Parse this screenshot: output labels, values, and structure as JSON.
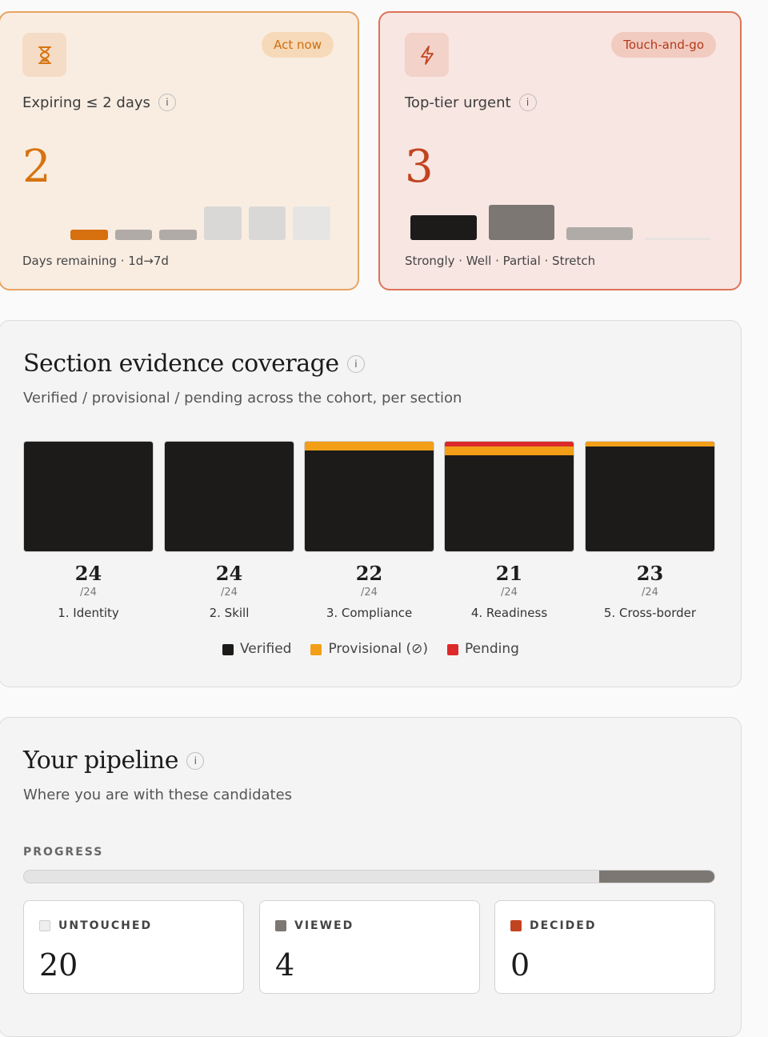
{
  "expiring_card": {
    "icon": "hourglass-icon",
    "badge": "Act now",
    "title": "Expiring ≤ 2 days",
    "value": "2",
    "footer": "Days remaining · 1d→7d",
    "accent": "#d77310",
    "bars": [
      {
        "level": 0.25,
        "color": "#d6700f"
      },
      {
        "level": 0.25,
        "color": "#b0aba6"
      },
      {
        "level": 0.25,
        "color": "#b0aba6"
      },
      {
        "level": 0.8,
        "color": "#dad8d6"
      },
      {
        "level": 0.8,
        "color": "#dad8d6"
      },
      {
        "level": 0.8,
        "color": "#e6e5e4"
      }
    ]
  },
  "urgent_card": {
    "icon": "lightning-icon",
    "badge": "Touch-and-go",
    "title": "Top-tier urgent",
    "value": "3",
    "footer": "Strongly · Well · Partial · Stretch",
    "accent": "#c2431f",
    "bars": [
      {
        "level": 0.6,
        "color": "#1c1b1a"
      },
      {
        "level": 0.85,
        "color": "#7c7772"
      },
      {
        "level": 0.3,
        "color": "#b0aba6"
      },
      {
        "level": 0.05,
        "color": "#e8e2df"
      }
    ]
  },
  "coverage": {
    "title": "Section evidence coverage",
    "subtitle": "Verified / provisional / pending across the cohort, per section",
    "total": "/24",
    "sections": [
      {
        "count": "24",
        "label": "1. Identity",
        "verified": 24,
        "provisional": 0,
        "pending": 0
      },
      {
        "count": "24",
        "label": "2. Skill",
        "verified": 24,
        "provisional": 0,
        "pending": 0
      },
      {
        "count": "22",
        "label": "3. Compliance",
        "verified": 22,
        "provisional": 2,
        "pending": 0
      },
      {
        "count": "21",
        "label": "4. Readiness",
        "verified": 21,
        "provisional": 2,
        "pending": 1
      },
      {
        "count": "23",
        "label": "5. Cross-border",
        "verified": 23,
        "provisional": 1,
        "pending": 0
      }
    ],
    "legend": [
      {
        "label": "Verified",
        "color": "#1c1b1a"
      },
      {
        "label": "Provisional (⊘)",
        "color": "#f29f17"
      },
      {
        "label": "Pending",
        "color": "#dc2a2a"
      }
    ]
  },
  "pipeline": {
    "title": "Your pipeline",
    "subtitle": "Where you are with these candidates",
    "progress_label": "PROGRESS",
    "untouched_fraction": 0.833,
    "stats": [
      {
        "label": "UNTOUCHED",
        "value": "20",
        "color": "#eeeeee"
      },
      {
        "label": "VIEWED",
        "value": "4",
        "color": "#7c7772"
      },
      {
        "label": "DECIDED",
        "value": "0",
        "color": "#c2431f"
      }
    ]
  }
}
